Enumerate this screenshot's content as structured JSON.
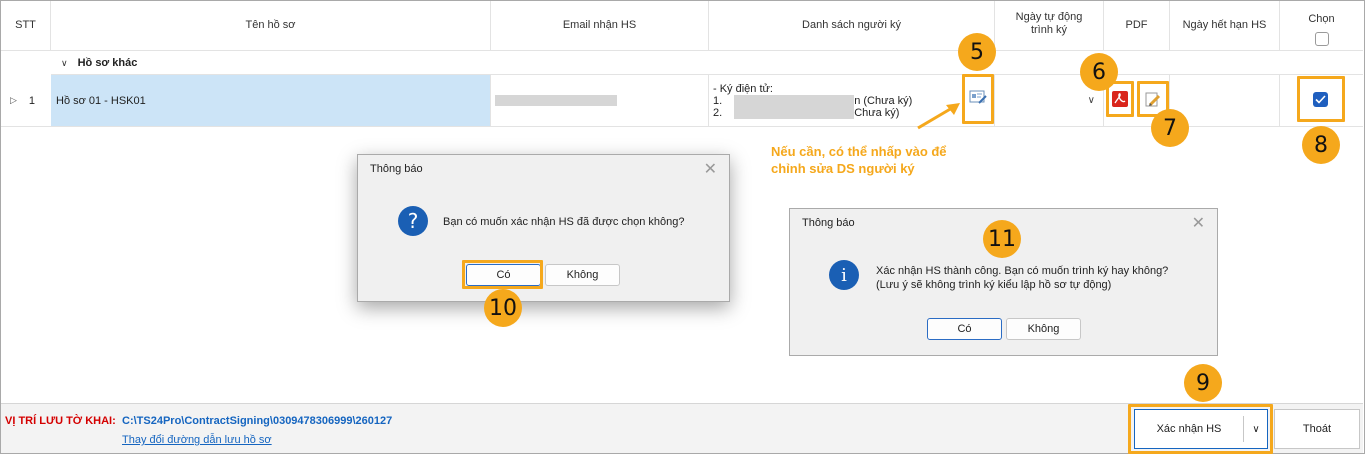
{
  "table": {
    "headers": {
      "stt": "STT",
      "ten_ho_so": "Tên hồ sơ",
      "email": "Email nhận HS",
      "danh_sach": "Danh sách người ký",
      "ngay_tu_dong": "Ngày tự động trình ký",
      "pdf": "PDF",
      "ngay_het_han": "Ngày hết hạn HS",
      "chon": "Chọn"
    },
    "group_label": "Hồ sơ khác",
    "row": {
      "stt": "1",
      "ten_ho_so": "Hồ sơ 01 - HSK01",
      "signer_heading": "- Ký điện tử:",
      "signer_1_index": "1.",
      "signer_1_tail": "n (Chưa ký)",
      "signer_2_index": "2.",
      "signer_2_tail": "Chưa ký)",
      "selected": true
    }
  },
  "annotation": {
    "hint_line_1": "Nếu cần, có thể nhấp vào để",
    "hint_line_2": "chỉnh sửa DS người ký",
    "badges": {
      "b5": "5",
      "b6": "6",
      "b7": "7",
      "b8": "8",
      "b9": "9",
      "b10": "10",
      "b11": "11"
    },
    "color": "#f5a81c"
  },
  "dialog_confirm": {
    "title": "Thông báo",
    "message": "Bạn có muốn xác nhận HS đã được chọn không?",
    "yes_label": "Có",
    "no_label": "Không"
  },
  "dialog_success": {
    "title": "Thông báo",
    "message_line_1": "Xác nhận HS thành công. Bạn có muốn trình ký hay không?",
    "message_line_2": "(Lưu ý sẽ không trình ký kiểu lập hồ sơ tự động)",
    "yes_label": "Có",
    "no_label": "Không"
  },
  "footer": {
    "save_location_label": "VỊ TRÍ LƯU TỜ KHAI:",
    "save_path": "C:\\TS24Pro\\ContractSigning\\0309478306999\\260127",
    "change_path_link": "Thay đổi đường dẫn lưu hồ sơ",
    "confirm_label": "Xác nhận HS",
    "exit_label": "Thoát"
  },
  "colors": {
    "row_selected": "#cce4f7",
    "accent_blue": "#1565c0",
    "footer_label_red": "#d40000",
    "path_blue": "#1565c0",
    "checkbox_blue": "#1f5fbf"
  }
}
